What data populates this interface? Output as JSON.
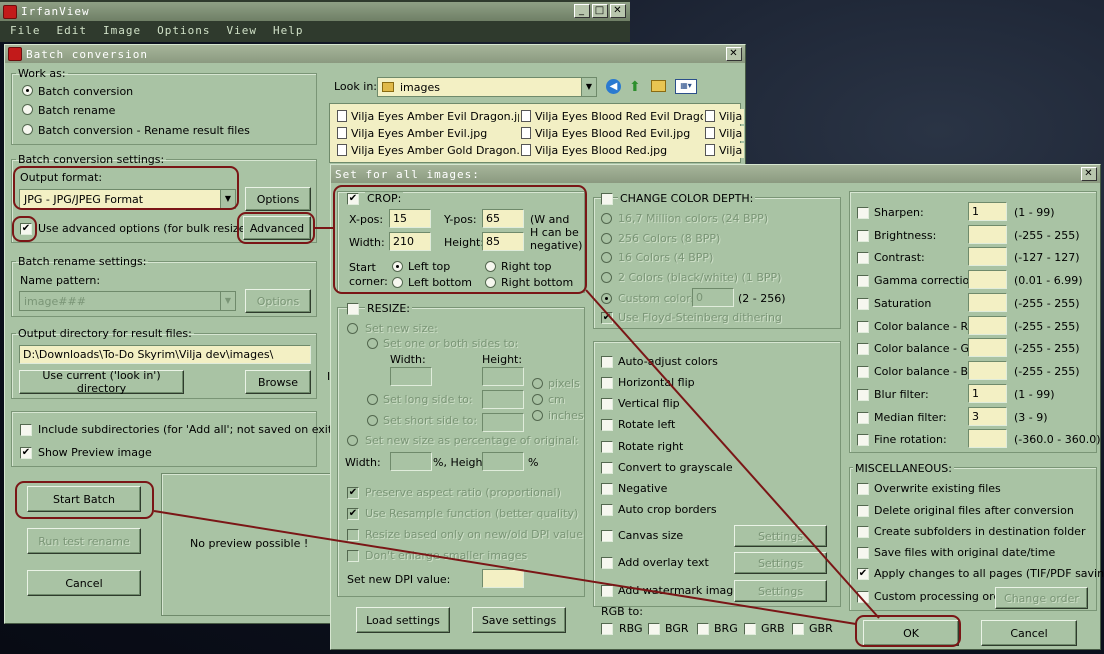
{
  "irfan": {
    "title": "IrfanView",
    "menu": [
      "File",
      "Edit",
      "Image",
      "Options",
      "View",
      "Help"
    ]
  },
  "batch": {
    "title": "Batch conversion",
    "work_as": {
      "legend": "Work as:",
      "options": [
        "Batch conversion",
        "Batch rename",
        "Batch conversion - Rename result files"
      ]
    },
    "conv_settings": {
      "legend": "Batch conversion settings:",
      "output_format_label": "Output format:",
      "output_format_value": "JPG - JPG/JPEG Format",
      "options_button": "Options",
      "advanced_check": "Use advanced options (for bulk resize...)",
      "advanced_button": "Advanced"
    },
    "rename_settings": {
      "legend": "Batch rename settings:",
      "name_pattern_label": "Name pattern:",
      "name_pattern_value": "image###",
      "options_button": "Options"
    },
    "output_dir": {
      "legend": "Output directory for result files:",
      "value": "D:\\Downloads\\To-Do Skyrim\\Vilja dev\\images\\",
      "current_button": "Use current ('look in') directory",
      "browse_button": "Browse"
    },
    "include_sub": "Include subdirectories (for 'Add all'; not saved on exit)",
    "show_preview": "Show Preview image",
    "start_batch": "Start Batch",
    "run_test": "Run test rename",
    "cancel": "Cancel",
    "no_preview": "No preview possible !",
    "look_in_label": "Look in:",
    "look_in_value": "images",
    "files_col1": [
      "Vilja Eyes Amber Evil Dragon.jpg",
      "Vilja Eyes Amber Evil.jpg",
      "Vilja Eyes Amber Gold Dragon.jpg"
    ],
    "files_col2": [
      "Vilja Eyes Blood Red Evil Dragon.jpg",
      "Vilja Eyes Blood Red Evil.jpg",
      "Vilja Eyes Blood Red.jpg"
    ],
    "files_col3": [
      "Vilja",
      "Vilja",
      "Vilja"
    ],
    "partial_i": "I"
  },
  "adv": {
    "title": "Set for all images:",
    "crop": {
      "legend": "CROP:",
      "xpos_label": "X-pos:",
      "xpos": "15",
      "ypos_label": "Y-pos:",
      "ypos": "65",
      "width_label": "Width:",
      "width": "210",
      "height_label": "Height:",
      "height": "85",
      "note": "(W and H can be negative)",
      "start_label": "Start corner:",
      "corners": [
        "Left top",
        "Right top",
        "Left bottom",
        "Right bottom"
      ]
    },
    "resize": {
      "legend": "RESIZE:",
      "set_new_size": "Set new size:",
      "one_or_both": "Set one or both sides to:",
      "width": "Width:",
      "height": "Height:",
      "long_side": "Set long side to:",
      "short_side": "Set short side to:",
      "pixels": "pixels",
      "cm": "cm",
      "inches": "inches",
      "percentage": "Set new size as percentage of original:",
      "w_pct": "Width:",
      "pct_h": "%, Height:",
      "pct": "%",
      "preserve": "Preserve aspect ratio (proportional)",
      "resample": "Use Resample function (better quality)",
      "dpi_resize": "Resize based only on new/old DPI value",
      "dont_enlarge": "Don't enlarge smaller images",
      "dpi_label": "Set new DPI value:"
    },
    "depth": {
      "legend": "CHANGE COLOR DEPTH:",
      "options": [
        "16,7 Million colors (24 BPP)",
        "256 Colors (8 BPP)",
        "16 Colors (4 BPP)",
        "2 Colors (black/white) (1 BPP)"
      ],
      "custom": "Custom colors:",
      "custom_value": "0",
      "custom_range": "(2 - 256)",
      "dither": "Use Floyd-Steinberg dithering"
    },
    "ops": [
      "Auto-adjust colors",
      "Horizontal flip",
      "Vertical flip",
      "Rotate left",
      "Rotate right",
      "Convert to grayscale",
      "Negative",
      "Auto crop borders"
    ],
    "canvas": "Canvas size",
    "overlay": "Add overlay text",
    "watermark": "Add watermark image",
    "settings": "Settings",
    "rgb_label": "RGB to:",
    "rgb": [
      "RBG",
      "BGR",
      "BRG",
      "GRB",
      "GBR"
    ],
    "filters": [
      {
        "label": "Sharpen:",
        "value": "1",
        "range": "(1 - 99)"
      },
      {
        "label": "Brightness:",
        "value": "",
        "range": "(-255 - 255)"
      },
      {
        "label": "Contrast:",
        "value": "",
        "range": "(-127 - 127)"
      },
      {
        "label": "Gamma correction:",
        "value": "",
        "range": "(0.01 - 6.99)"
      },
      {
        "label": "Saturation",
        "value": "",
        "range": "(-255 - 255)"
      },
      {
        "label": "Color balance - R:",
        "value": "",
        "range": "(-255 - 255)"
      },
      {
        "label": "Color balance - G:",
        "value": "",
        "range": "(-255 - 255)"
      },
      {
        "label": "Color balance - B:",
        "value": "",
        "range": "(-255 - 255)"
      },
      {
        "label": "Blur filter:",
        "value": "1",
        "range": "(1 - 99)"
      },
      {
        "label": "Median filter:",
        "value": "3",
        "range": "(3 - 9)"
      },
      {
        "label": "Fine rotation:",
        "value": "",
        "range": "(-360.0 - 360.0)"
      }
    ],
    "misc": {
      "legend": "MISCELLANEOUS:",
      "options": [
        "Overwrite existing files",
        "Delete original files after conversion",
        "Create subfolders in destination folder",
        "Save files with original date/time",
        "Apply changes to all pages (TIF/PDF saving)",
        "Custom processing order"
      ],
      "change_order": "Change order"
    },
    "load": "Load settings",
    "save": "Save settings",
    "ok": "OK",
    "cancel": "Cancel"
  },
  "colors": {
    "dialog_bg": "#a9c3a4",
    "field_bg": "#f3f0c4",
    "annotation": "#7a1616"
  }
}
